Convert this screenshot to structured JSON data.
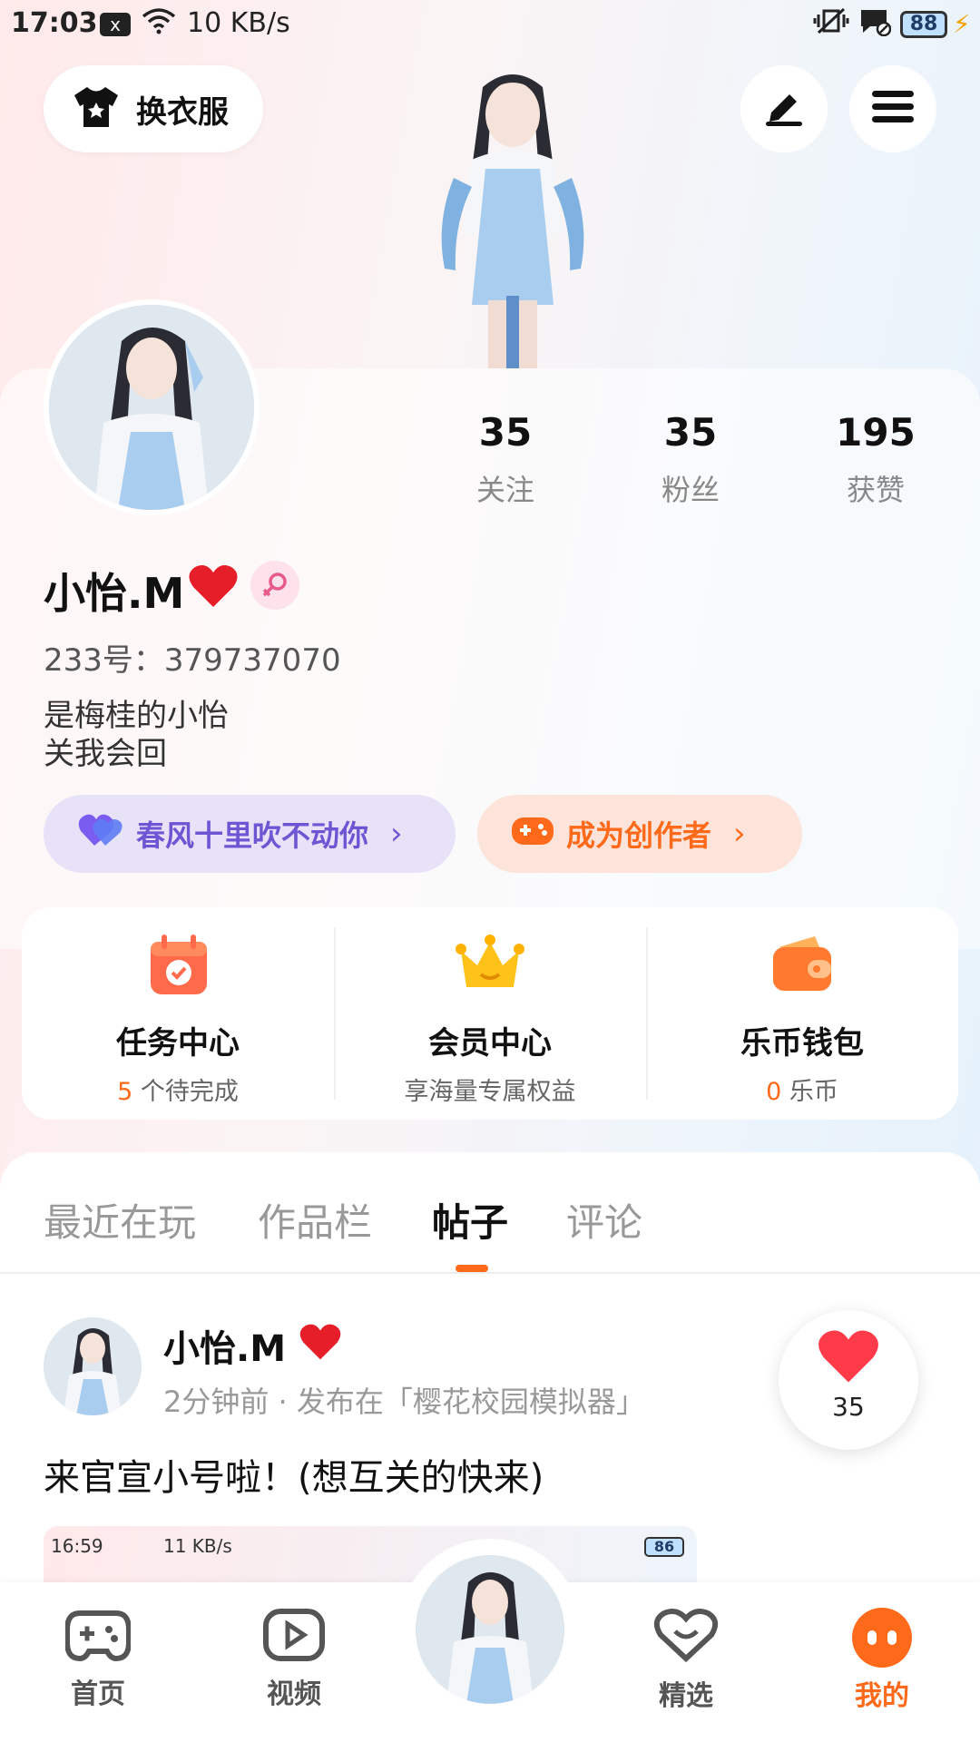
{
  "status_bar": {
    "time": "17:03",
    "sim_icon": "x",
    "net_speed": "10 KB/s",
    "battery": "88",
    "icons": [
      "sim-x-icon",
      "wifi-icon",
      "vibrate-icon",
      "message-icon",
      "battery-icon",
      "charging-icon"
    ]
  },
  "header": {
    "outfit_label": "换衣服",
    "edit_icon": "edit-icon",
    "menu_icon": "menu-icon"
  },
  "stats": [
    {
      "value": "35",
      "label": "关注"
    },
    {
      "value": "35",
      "label": "粉丝"
    },
    {
      "value": "195",
      "label": "获赞"
    }
  ],
  "profile": {
    "name": "小怡.M",
    "name_heart": "❤️",
    "gender_icon": "female-icon",
    "uid_line": "233号：379737070",
    "bio_line1": "是梅桂的小怡",
    "bio_line2": "关我会回"
  },
  "pills": {
    "vip_label": "春风十里吹不动你",
    "creator_label": "成为创作者",
    "chevron": "›"
  },
  "quick": [
    {
      "title": "任务中心",
      "sub_highlight": "5",
      "sub_rest": " 个待完成",
      "icon": "calendar-check-icon"
    },
    {
      "title": "会员中心",
      "sub_highlight": "",
      "sub_rest": "享海量专属权益",
      "icon": "crown-icon"
    },
    {
      "title": "乐币钱包",
      "sub_highlight": "0",
      "sub_rest": " 乐币",
      "icon": "wallet-icon"
    }
  ],
  "tabs": [
    {
      "label": "最近在玩",
      "active": false
    },
    {
      "label": "作品栏",
      "active": false
    },
    {
      "label": "帖子",
      "active": true
    },
    {
      "label": "评论",
      "active": false
    }
  ],
  "post": {
    "author": "小怡.M",
    "author_heart": "❤️",
    "meta": "2分钟前 · 发布在「樱花校园模拟器」",
    "text": "来官宣小号啦！(想互关的快来)",
    "like_count": "35",
    "image_status_time": "16:59",
    "image_status_speed": "11 KB/s",
    "image_battery": "86"
  },
  "bottom_nav": [
    {
      "label": "首页",
      "icon": "gamepad-icon",
      "active": false
    },
    {
      "label": "视频",
      "icon": "video-play-icon",
      "active": false
    },
    {
      "label": "精选",
      "icon": "heart-smile-icon",
      "active": false
    },
    {
      "label": "我的",
      "icon": "me-face-icon",
      "active": true
    }
  ],
  "colors": {
    "accent": "#ff6a1a",
    "vip_purple": "#6c56d4",
    "vip_bg": "#e7e2f8",
    "creator_bg": "#fde4da"
  }
}
